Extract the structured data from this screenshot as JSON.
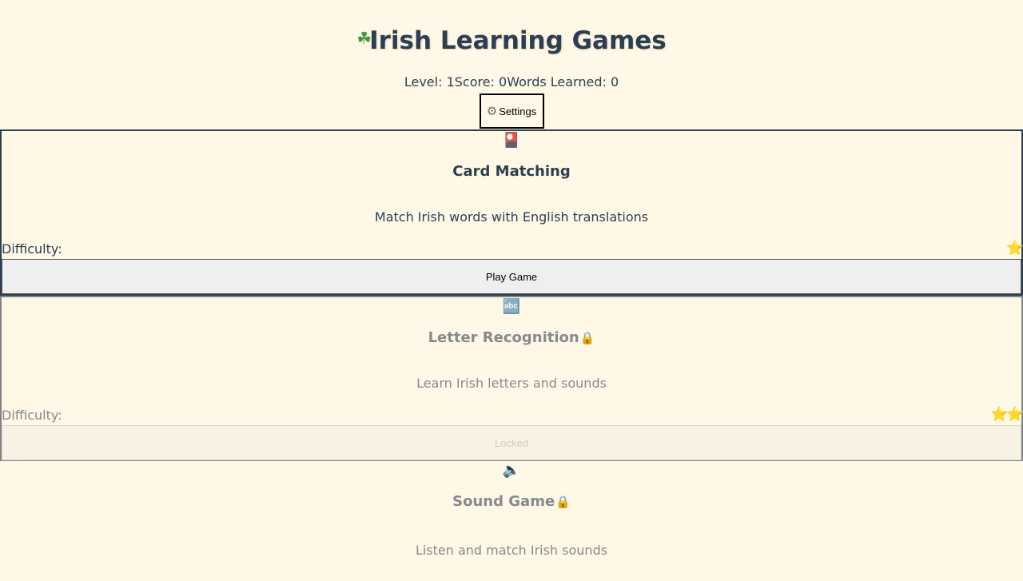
{
  "header": {
    "icon": "shamrock-icon",
    "icon_glyph": "☘",
    "title": "Irish Learning Games",
    "level": "Level: 1",
    "score": "Score: 0",
    "words_learned": "Words Learned: 0",
    "settings_icon": "gear-icon",
    "settings_glyph": "⚙",
    "settings_label": "Settings"
  },
  "games": [
    {
      "icon": "playing-card-icon",
      "icon_glyph": "🎴",
      "name": "Card Matching",
      "description": "Match Irish words with English translations",
      "difficulty_label": "Difficulty:",
      "stars": "⭐",
      "button_label": "Play Game",
      "locked": false
    },
    {
      "icon": "abc-letters-icon",
      "icon_glyph": "🔤",
      "name": "Letter Recognition",
      "lock_glyph": "🔒",
      "description": "Learn Irish letters and sounds",
      "difficulty_label": "Difficulty:",
      "stars": "⭐⭐",
      "button_label": "Locked",
      "locked": true
    },
    {
      "icon": "speaker-icon",
      "icon_glyph": "🔈",
      "name": "Sound Game",
      "lock_glyph": "🔒",
      "description": "Listen and match Irish sounds",
      "locked": true
    }
  ],
  "colors": {
    "background": "#fff8e6",
    "text": "#2c3e50",
    "locked_text": "#868a8e",
    "star": "#f2c230"
  }
}
